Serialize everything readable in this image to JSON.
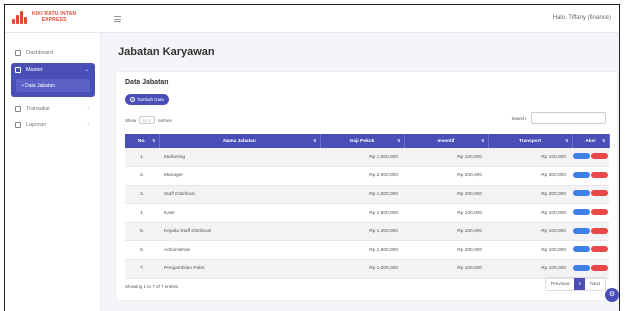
{
  "brand": {
    "line1": "KIKI RATU INTAN",
    "line2": "EXPRESS"
  },
  "header": {
    "greeting": "Halo, Tiffany (finance)"
  },
  "sidebar": {
    "dashboard": "Dashboard",
    "master": "Master",
    "master_sub": "Data Jabatan",
    "transaksi": "Transaksi",
    "laporan": "Laporan"
  },
  "page": {
    "title": "Jabatan Karyawan"
  },
  "card": {
    "title": "Data Jabatan",
    "add_button": "Tambah Data",
    "show_label": "Show",
    "show_value": "10",
    "entries_label": "entries",
    "search_label": "Search:"
  },
  "table": {
    "headers": [
      "No.",
      "Nama Jabatan",
      "Gaji Pokok",
      "Insentif",
      "Transport",
      "Aksi"
    ],
    "rows": [
      {
        "no": "1.",
        "nama": "Marketing",
        "gaji": "Rp 1,000,000",
        "insentif": "Rp 100,000",
        "transport": "Rp 100,000"
      },
      {
        "no": "2.",
        "nama": "Manager",
        "gaji": "Rp 2,000,000",
        "insentif": "Rp 200,000",
        "transport": "Rp 300,000"
      },
      {
        "no": "3.",
        "nama": "Staff Distribusi",
        "gaji": "Rp 1,000,000",
        "insentif": "Rp 200,000",
        "transport": "Rp 300,000"
      },
      {
        "no": "4.",
        "nama": "Kasir",
        "gaji": "Rp 1,500,000",
        "insentif": "Rp 100,000",
        "transport": "Rp 100,000"
      },
      {
        "no": "5.",
        "nama": "Kepala Staff Distribusi",
        "gaji": "Rp 1,300,000",
        "insentif": "Rp 100,000",
        "transport": "Rp 100,000"
      },
      {
        "no": "6.",
        "nama": "Administrasi",
        "gaji": "Rp 1,800,000",
        "insentif": "Rp 200,000",
        "transport": "Rp 100,000"
      },
      {
        "no": "7.",
        "nama": "Pengambilan Palet",
        "gaji": "Rp 1,000,000",
        "insentif": "Rp 100,000",
        "transport": "Rp 100,000"
      }
    ]
  },
  "footer": {
    "showing": "Showing 1 to 7 of 7 entries"
  },
  "pagination": {
    "previous": "Previous",
    "current": "1",
    "next": "Next"
  },
  "colors": {
    "primary": "#4a4fb8",
    "edit": "#3f7fe6",
    "delete": "#e84848",
    "brand": "#e2492f"
  }
}
